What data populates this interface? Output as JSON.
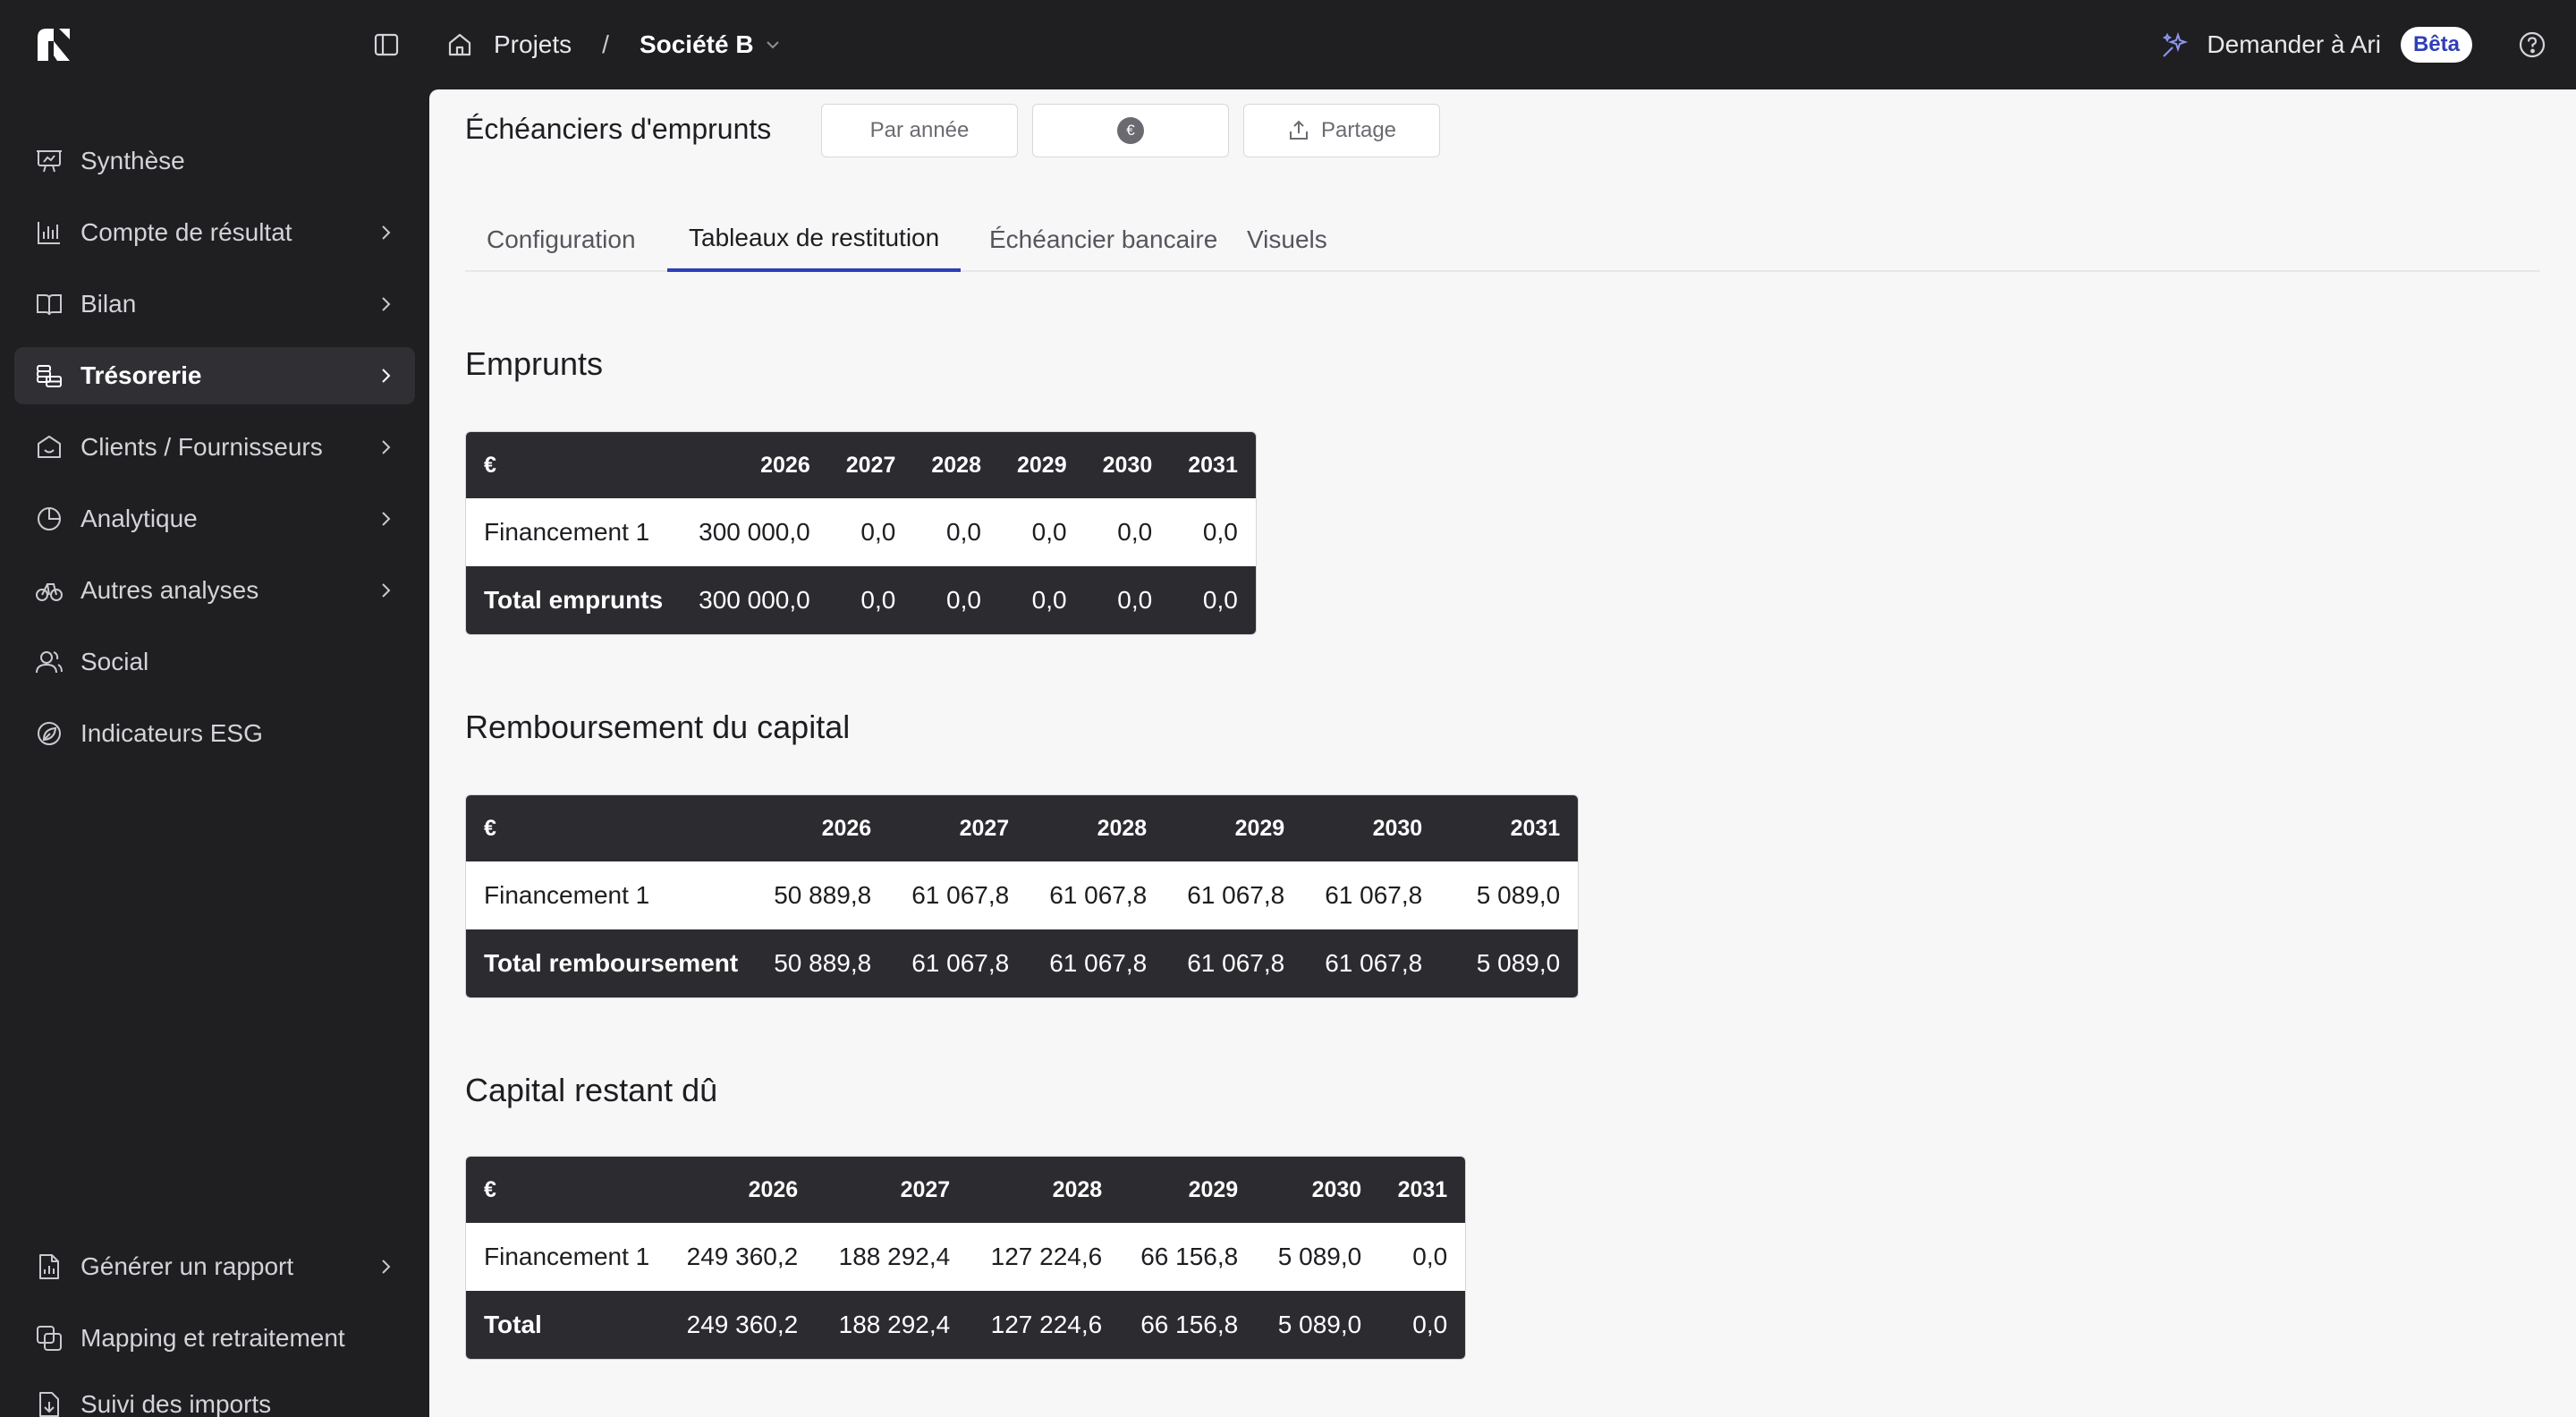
{
  "topbar": {
    "breadcrumb_root": "Projets",
    "breadcrumb_separator": "/",
    "breadcrumb_company": "Société B",
    "ask_label": "Demander à Ari",
    "beta_badge": "Bêta"
  },
  "sidebar": {
    "items": [
      {
        "label": "Synthèse",
        "icon": "presentation-icon",
        "chevron": false,
        "active": false
      },
      {
        "label": "Compte de résultat",
        "icon": "bar-chart-icon",
        "chevron": true,
        "active": false
      },
      {
        "label": "Bilan",
        "icon": "book-icon",
        "chevron": true,
        "active": false
      },
      {
        "label": "Trésorerie",
        "icon": "coins-icon",
        "chevron": true,
        "active": true
      },
      {
        "label": "Clients / Fournisseurs",
        "icon": "store-icon",
        "chevron": true,
        "active": false
      },
      {
        "label": "Analytique",
        "icon": "pie-chart-icon",
        "chevron": true,
        "active": false
      },
      {
        "label": "Autres analyses",
        "icon": "scale-icon",
        "chevron": true,
        "active": false
      },
      {
        "label": "Social",
        "icon": "users-icon",
        "chevron": false,
        "active": false
      },
      {
        "label": "Indicateurs ESG",
        "icon": "leaf-icon",
        "chevron": false,
        "active": false
      }
    ],
    "bottom_items": [
      {
        "label": "Générer un rapport",
        "icon": "file-chart-icon",
        "chevron": true
      },
      {
        "label": "Mapping et retraitement",
        "icon": "copy-icon",
        "chevron": false
      },
      {
        "label": "Suivi des imports",
        "icon": "import-icon",
        "chevron": false
      }
    ]
  },
  "main": {
    "title": "Échéanciers d'emprunts",
    "period_button": "Par année",
    "currency_symbol": "€",
    "share_button": "Partage",
    "tabs": [
      "Configuration",
      "Tableaux de restitution",
      "Échéancier bancaire",
      "Visuels"
    ],
    "active_tab": 1
  },
  "tables": {
    "emprunts": {
      "title": "Emprunts",
      "currency": "€",
      "years": [
        "2026",
        "2027",
        "2028",
        "2029",
        "2030",
        "2031"
      ],
      "row_label": "Financement 1",
      "row_values": [
        "300 000,0",
        "0,0",
        "0,0",
        "0,0",
        "0,0",
        "0,0"
      ],
      "total_label": "Total emprunts",
      "total_values": [
        "300 000,0",
        "0,0",
        "0,0",
        "0,0",
        "0,0",
        "0,0"
      ]
    },
    "remboursement": {
      "title": "Remboursement du capital",
      "currency": "€",
      "years": [
        "2026",
        "2027",
        "2028",
        "2029",
        "2030",
        "2031"
      ],
      "row_label": "Financement 1",
      "row_values": [
        "50 889,8",
        "61 067,8",
        "61 067,8",
        "61 067,8",
        "61 067,8",
        "5 089,0"
      ],
      "total_label": "Total remboursement",
      "total_values": [
        "50 889,8",
        "61 067,8",
        "61 067,8",
        "61 067,8",
        "61 067,8",
        "5 089,0"
      ]
    },
    "capital": {
      "title": "Capital restant dû",
      "currency": "€",
      "years": [
        "2026",
        "2027",
        "2028",
        "2029",
        "2030",
        "2031"
      ],
      "row_label": "Financement 1",
      "row_values": [
        "249 360,2",
        "188 292,4",
        "127 224,6",
        "66 156,8",
        "5 089,0",
        "0,0"
      ],
      "total_label": "Total",
      "total_values": [
        "249 360,2",
        "188 292,4",
        "127 224,6",
        "66 156,8",
        "5 089,0",
        "0,0"
      ]
    }
  }
}
